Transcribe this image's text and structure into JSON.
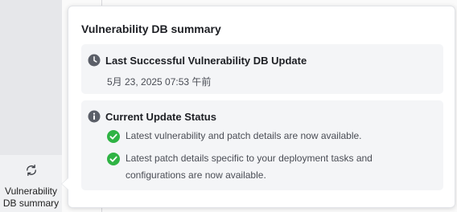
{
  "sidebar": {
    "active_item": {
      "icon": "refresh-icon",
      "label": "Vulnerability\nDB summary"
    }
  },
  "popover": {
    "title": "Vulnerability DB summary",
    "last_update": {
      "icon": "clock-icon",
      "title": "Last Successful Vulnerability DB Update",
      "value": "5月 23, 2025 07:53 午前"
    },
    "current_status": {
      "icon": "info-icon",
      "title": "Current Update Status",
      "items": [
        {
          "icon": "check-circle-icon",
          "text": "Latest vulnerability and patch details are now available."
        },
        {
          "icon": "check-circle-icon",
          "text": "Latest patch details specific to your deployment tasks and configurations are now available."
        }
      ]
    }
  },
  "colors": {
    "success": "#2fb344",
    "icon_dark": "#5b5f68",
    "card_bg": "#f4f5f7",
    "rail_bg": "#e6e7ea"
  }
}
